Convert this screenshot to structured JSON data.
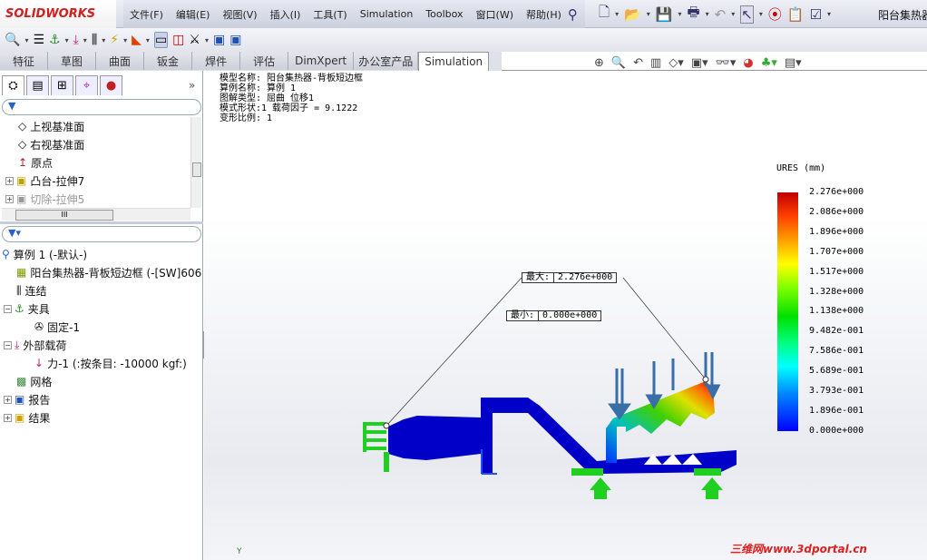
{
  "app": {
    "logo": "SOLIDWORKS",
    "document_title": "阳台集热器"
  },
  "menu": [
    "文件(F)",
    "编辑(E)",
    "视图(V)",
    "插入(I)",
    "工具(T)",
    "Simulation",
    "Toolbox",
    "窗口(W)",
    "帮助(H)"
  ],
  "command_tabs": [
    "特征",
    "草图",
    "曲面",
    "钣金",
    "焊件",
    "评估",
    "DimXpert",
    "办公室产品",
    "Simulation"
  ],
  "active_tab": "Simulation",
  "feature_tree": {
    "items": [
      {
        "label": "上视基准面",
        "icon": "plane-icon"
      },
      {
        "label": "右视基准面",
        "icon": "plane-icon"
      },
      {
        "label": "原点",
        "icon": "origin-icon"
      },
      {
        "label": "凸台-拉伸7",
        "icon": "boss-extrude-icon",
        "expandable": true
      },
      {
        "label": "切除-拉伸5",
        "icon": "cut-extrude-icon",
        "expandable": true,
        "grayed": true
      }
    ],
    "hscroll_label": "III"
  },
  "sim_tree": {
    "study": "算例 1 (-默认-)",
    "items": [
      {
        "label": "阳台集热器-背板短边框 (-[SW]606",
        "indent": 1
      },
      {
        "label": "连结",
        "indent": 1
      },
      {
        "label": "夹具",
        "indent": 1,
        "expander": "−"
      },
      {
        "label": "固定-1",
        "indent": 2
      },
      {
        "label": "外部载荷",
        "indent": 1,
        "expander": "−"
      },
      {
        "label": "力-1 (:按条目: -10000 kgf:)",
        "indent": 2
      },
      {
        "label": "网格",
        "indent": 1
      },
      {
        "label": "报告",
        "indent": 1,
        "expander": "+"
      },
      {
        "label": "结果",
        "indent": 1,
        "expander": "+"
      }
    ]
  },
  "plot_info": [
    "模型名称: 阳台集热器-背板短边框",
    "算例名称: 算例 1",
    "图解类型: 屈曲 位移1",
    "模式形状:1   载荷因子 = 9.1222",
    "变形比例: 1"
  ],
  "legend": {
    "title": "URES (mm)",
    "labels": [
      "2.276e+000",
      "2.086e+000",
      "1.896e+000",
      "1.707e+000",
      "1.517e+000",
      "1.328e+000",
      "1.138e+000",
      "9.482e-001",
      "7.586e-001",
      "5.689e-001",
      "3.793e-001",
      "1.896e-001",
      "0.000e+000"
    ]
  },
  "callouts": {
    "max_label": "最大:",
    "max_value": "2.276e+000",
    "min_label": "最小:",
    "min_value": "0.000e+000"
  },
  "triad_label": "Y",
  "watermark": "三维网www.3dportal.cn"
}
